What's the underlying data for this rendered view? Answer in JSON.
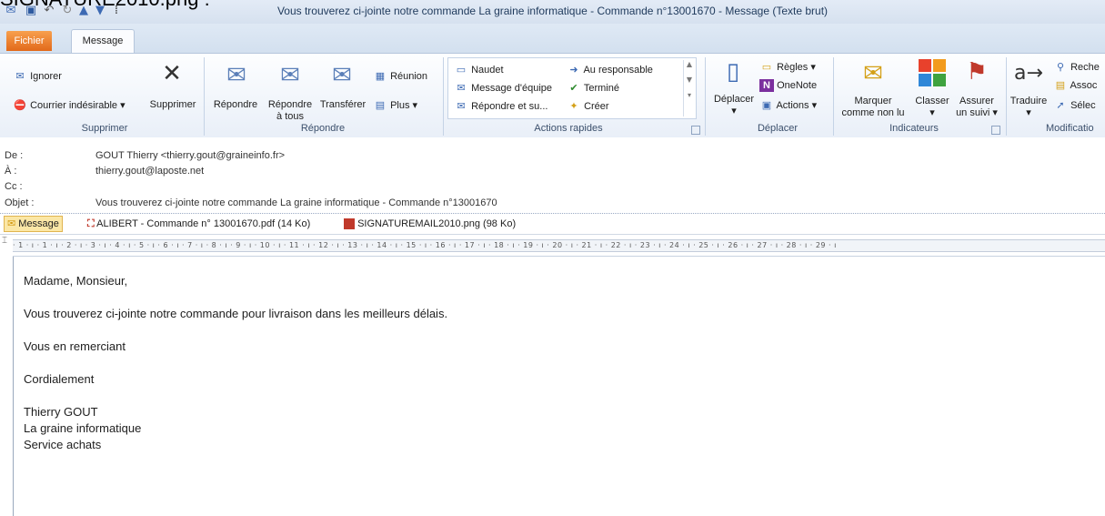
{
  "caption": "SIGNATURE2010.png :",
  "window": {
    "title": "Vous trouverez ci-jointe notre commande La graine informatique - Commande n°13001670 - Message (Texte brut)"
  },
  "tabs": {
    "fichier": "Fichier",
    "message": "Message"
  },
  "ribbon": {
    "supprimer": {
      "ignorer": "Ignorer",
      "courrier": "Courrier indésirable ▾",
      "supprimer": "Supprimer",
      "label": "Supprimer"
    },
    "repondre": {
      "repondre": "Répondre",
      "repondre_tous_1": "Répondre",
      "repondre_tous_2": "à tous",
      "transferer": "Transférer",
      "reunion": "Réunion",
      "plus": "Plus ▾",
      "label": "Répondre"
    },
    "actions_rapides": {
      "naudet": "Naudet",
      "message_equipe": "Message d'équipe",
      "repondre_su": "Répondre et su...",
      "au_responsable": "Au responsable",
      "termine": "Terminé",
      "creer": "Créer",
      "label": "Actions rapides"
    },
    "deplacer": {
      "deplacer": "Déplacer",
      "regles": "Règles ▾",
      "onenote": "OneNote",
      "actions": "Actions ▾",
      "label": "Déplacer"
    },
    "indicateurs": {
      "marquer_1": "Marquer",
      "marquer_2": "comme non lu",
      "classer": "Classer",
      "classer_arrow": "▾",
      "assurer_1": "Assurer",
      "assurer_2": "un suivi ▾",
      "label": "Indicateurs"
    },
    "modification": {
      "traduire": "Traduire",
      "traduire_arrow": "▾",
      "rech": "Reche",
      "assoc": "Assoc",
      "selec": "Sélec",
      "label": "Modificatio"
    }
  },
  "headers": {
    "de_label": "De :",
    "de_value": "GOUT Thierry <thierry.gout@graineinfo.fr>",
    "a_label": "À :",
    "a_value": "thierry.gout@laposte.net",
    "cc_label": "Cc :",
    "cc_value": "",
    "objet_label": "Objet :",
    "objet_value": "Vous trouverez ci-jointe notre commande La graine informatique - Commande n°13001670"
  },
  "attachments": {
    "message": "Message",
    "pdf": "ALIBERT  - Commande n° 13001670.pdf (14 Ko)",
    "png": "SIGNATUREMAIL2010.png (98 Ko)"
  },
  "ruler": "· 1 · ı · 1 · ı · 2 · ı · 3 · ı · 4 · ı · 5 · ı · 6 · ı · 7 · ı · 8 · ı · 9 · ı · 10 · ı · 11 · ı · 12 · ı · 13 · ı · 14 · ı · 15 · ı · 16 · ı · 17 · ı · 18 · ı · 19 · ı · 20 · ı · 21 · ı · 22 · ı · 23 · ı · 24 · ı · 25 · ı · 26 · ı · 27 · ı · 28 · ı · 29 · ı",
  "body": {
    "greeting": "Madame, Monsieur,",
    "line1": "Vous trouverez ci-jointe notre commande pour livraison dans les meilleurs délais.",
    "line2": "Vous en remerciant",
    "line3": "Cordialement",
    "sig1": "Thierry GOUT",
    "sig2": "La graine informatique",
    "sig3": "Service achats"
  },
  "colors": {
    "fichier_tab": "#e2691a",
    "ribbon_bg": "#e9eff8",
    "flag": "#c0392b"
  }
}
